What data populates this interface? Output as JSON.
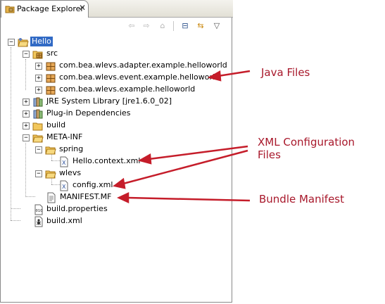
{
  "view": {
    "title": "Package Explorer",
    "close_glyph": "✕"
  },
  "toolbar": {
    "back": "⇦",
    "forward": "⇨",
    "home": "⌂",
    "collapse": "⊟",
    "link": "⇆",
    "menu": "▽"
  },
  "tree": {
    "hello": "Hello",
    "src": "src",
    "pkg1": "com.bea.wlevs.adapter.example.helloworld",
    "pkg2": "com.bea.wlevs.event.example.helloworld",
    "pkg3": "com.bea.wlevs.example.helloworld",
    "jre": "JRE System Library [jre1.6.0_02]",
    "plugins": "Plug-in Dependencies",
    "build": "build",
    "metainf": "META-INF",
    "spring": "spring",
    "hellocontext": "Hello.context.xml",
    "wlevs": "wlevs",
    "config": "config.xml",
    "manifest": "MANIFEST.MF",
    "buildprops": "build.properties",
    "buildxml": "build.xml"
  },
  "callouts": {
    "java": "Java Files",
    "xml_line1": "XML Configuration",
    "xml_line2": "Files",
    "manifest": "Bundle Manifest"
  },
  "colors": {
    "selection": "#316ac5",
    "callout": "#a8182b"
  }
}
